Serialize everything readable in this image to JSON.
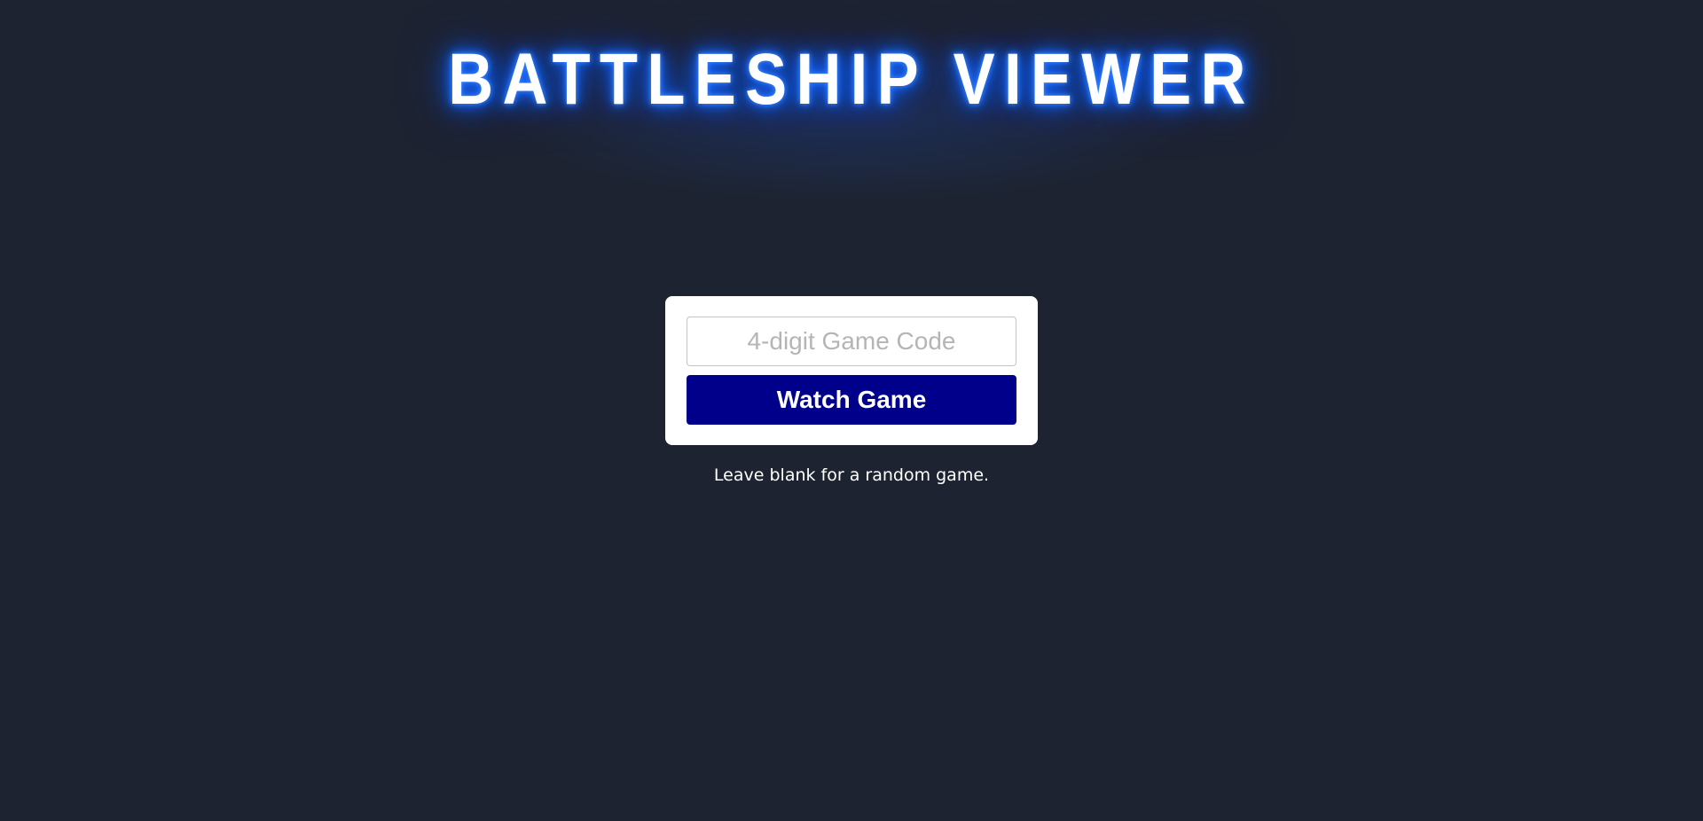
{
  "header": {
    "title": "BATTLESHIP VIEWER"
  },
  "form": {
    "code_placeholder": "4-digit Game Code",
    "code_value": "",
    "watch_button_label": "Watch Game"
  },
  "hint": {
    "text": "Leave blank for a random game."
  },
  "colors": {
    "background": "#1d2331",
    "title_glow": "#1160ff",
    "button_bg": "#00008b",
    "card_bg": "#ffffff"
  }
}
